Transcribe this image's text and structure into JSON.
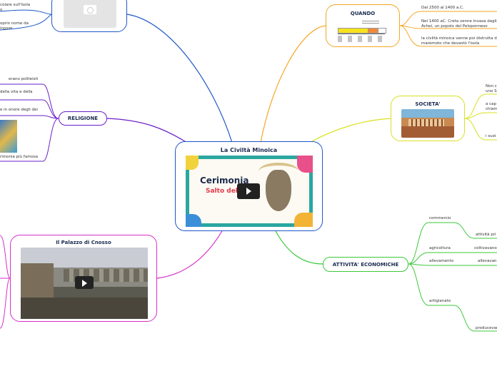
{
  "central": {
    "title": "La Civiltà Minoica",
    "video_title_line1": "Cerimonia",
    "video_title_line2": "Salto del toro"
  },
  "quando": {
    "title": "QUANDO",
    "leaves": [
      "Dal 2500 al 1400 a.C.",
      "Nel 1400 aC. Creta venne invasa dagli Achei, un popolo del Peloponneso",
      "la civiltà minoica venne poi distrutta da un maremoto che devastò l'isola"
    ]
  },
  "societa": {
    "title": "SOCIETA'",
    "leaves": [
      "Non c'era uno S",
      "a capo chiam",
      "i suoi"
    ]
  },
  "religione": {
    "title": "RELIGIONE",
    "leaves": [
      "erano politeisti",
      "della vita e della",
      "e in onore degli dei",
      "rimonia più famosa"
    ]
  },
  "attivita": {
    "title": "ATTIVITA' ECONOMICHE",
    "branches": [
      "commercio",
      "agricoltura",
      "allevamento",
      "artigianato"
    ],
    "leaves": [
      "attività pri",
      "coltivavano",
      "allevavan",
      "producevan"
    ]
  },
  "palazzo": {
    "title": "Il Palazzo di Cnosso"
  },
  "topleft": {
    "leaves": [
      "colare sull'Isola",
      "o",
      "oprio nome da",
      "inosse"
    ]
  },
  "colors": {
    "blue": "#1f57c9",
    "orange": "#f5a623",
    "yellow": "#d9e021",
    "purple": "#6a1fc9",
    "green": "#3cc93a",
    "magenta": "#d62fc9"
  }
}
